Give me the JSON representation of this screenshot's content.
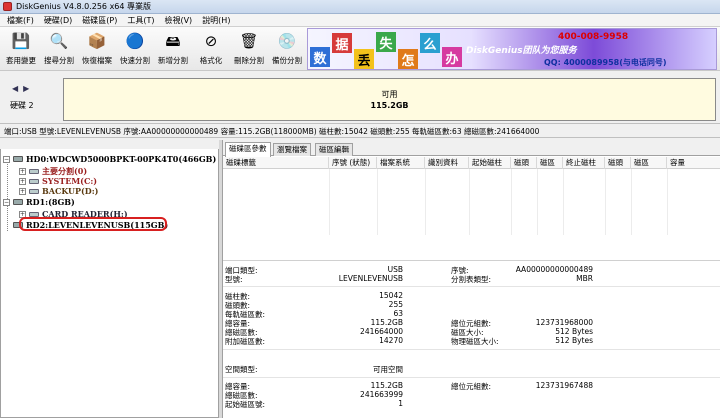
{
  "window": {
    "title": "DiskGenius V4.8.0.256 x64 專業版"
  },
  "menu": [
    "檔案(F)",
    "硬碟(D)",
    "磁碟區(P)",
    "工具(T)",
    "檢視(V)",
    "說明(H)"
  ],
  "toolbar": [
    {
      "label": "套用變更",
      "icon": "save-icon",
      "glyph": "💾"
    },
    {
      "label": "搜尋分割",
      "icon": "search-icon",
      "glyph": "🔍"
    },
    {
      "label": "恢復檔案",
      "icon": "recover-icon",
      "glyph": "📦"
    },
    {
      "label": "快速分割",
      "icon": "quick-partition-icon",
      "glyph": "🔵"
    },
    {
      "label": "新增分割",
      "icon": "new-partition-icon",
      "glyph": "🖴"
    },
    {
      "label": "格式化",
      "icon": "format-icon",
      "glyph": "⊘"
    },
    {
      "label": "刪除分割",
      "icon": "delete-icon",
      "glyph": "🗑"
    },
    {
      "label": "備份分割",
      "icon": "backup-icon",
      "glyph": "💿"
    }
  ],
  "banner": {
    "chars": [
      "数",
      "据",
      "丢",
      "失",
      "怎",
      "么",
      "办"
    ],
    "brand": "DiskGenius团队为您服务",
    "tel": "400-008-9958",
    "qq": "QQ: 4000089958(与电话同号)"
  },
  "diskbar": {
    "label": "硬碟 2",
    "partition_title": "可用",
    "partition_size": "115.2GB"
  },
  "info_line": "端口:USB  型號:LEVENLEVENUSB  序號:AA00000000000489  容量:115.2GB(118000MB)  磁柱數:15042  磁頭數:255  每軌磁區數:63  總磁區數:241664000",
  "tree": {
    "hd0": "HD0:WDCWD5000BPKT-00PK4T0(466GB)",
    "hd0_p1": "主要分割(0)",
    "hd0_p2": "SYSTEM(C:)",
    "hd0_p3": "BACKUP(D:)",
    "rd1": "RD1:(8GB)",
    "rd1_p1": "CARD READER(H:)",
    "rd2": "RD2:LEVENLEVENUSB(115GB)"
  },
  "tabs": [
    "磁碟區參數",
    "瀏覽檔案",
    "磁區編輯"
  ],
  "columns": [
    "磁碟標籤",
    "序號 (狀態)",
    "檔案系統",
    "識別資料",
    "起始磁柱",
    "磁頭",
    "磁區",
    "終止磁柱",
    "磁頭",
    "磁區",
    "容量"
  ],
  "props": {
    "interface_label": "端口類型:",
    "interface_value": "USB",
    "model_label": "型號:",
    "model_value": "LEVENLEVENUSB",
    "serial_label": "序號:",
    "serial_value": "AA00000000000489",
    "ptable_label": "分割表類型:",
    "ptable_value": "MBR",
    "cyl_label": "磁柱數:",
    "cyl_value": "15042",
    "heads_label": "磁頭數:",
    "heads_value": "255",
    "spt_label": "每軌磁區數:",
    "spt_value": "63",
    "cap_label": "總容量:",
    "cap_value": "115.2GB",
    "totalbytes_label": "總位元組數:",
    "totalbytes_value": "123731968000",
    "sectors_label": "總磁區數:",
    "sectors_value": "241664000",
    "secsize_label": "磁區大小:",
    "secsize_value": "512 Bytes",
    "extra_label": "附加磁區數:",
    "extra_value": "14270",
    "physsec_label": "物理磁區大小:",
    "physsec_value": "512 Bytes",
    "space_label": "空間類型:",
    "space_value": "可用空間",
    "cap2_label": "總容量:",
    "cap2_value": "115.2GB",
    "bytes2_label": "總位元組數:",
    "bytes2_value": "123731967488",
    "sec2_label": "總磁區數:",
    "sec2_value": "241663999",
    "start_label": "起始磁區號:",
    "start_value": "1"
  }
}
